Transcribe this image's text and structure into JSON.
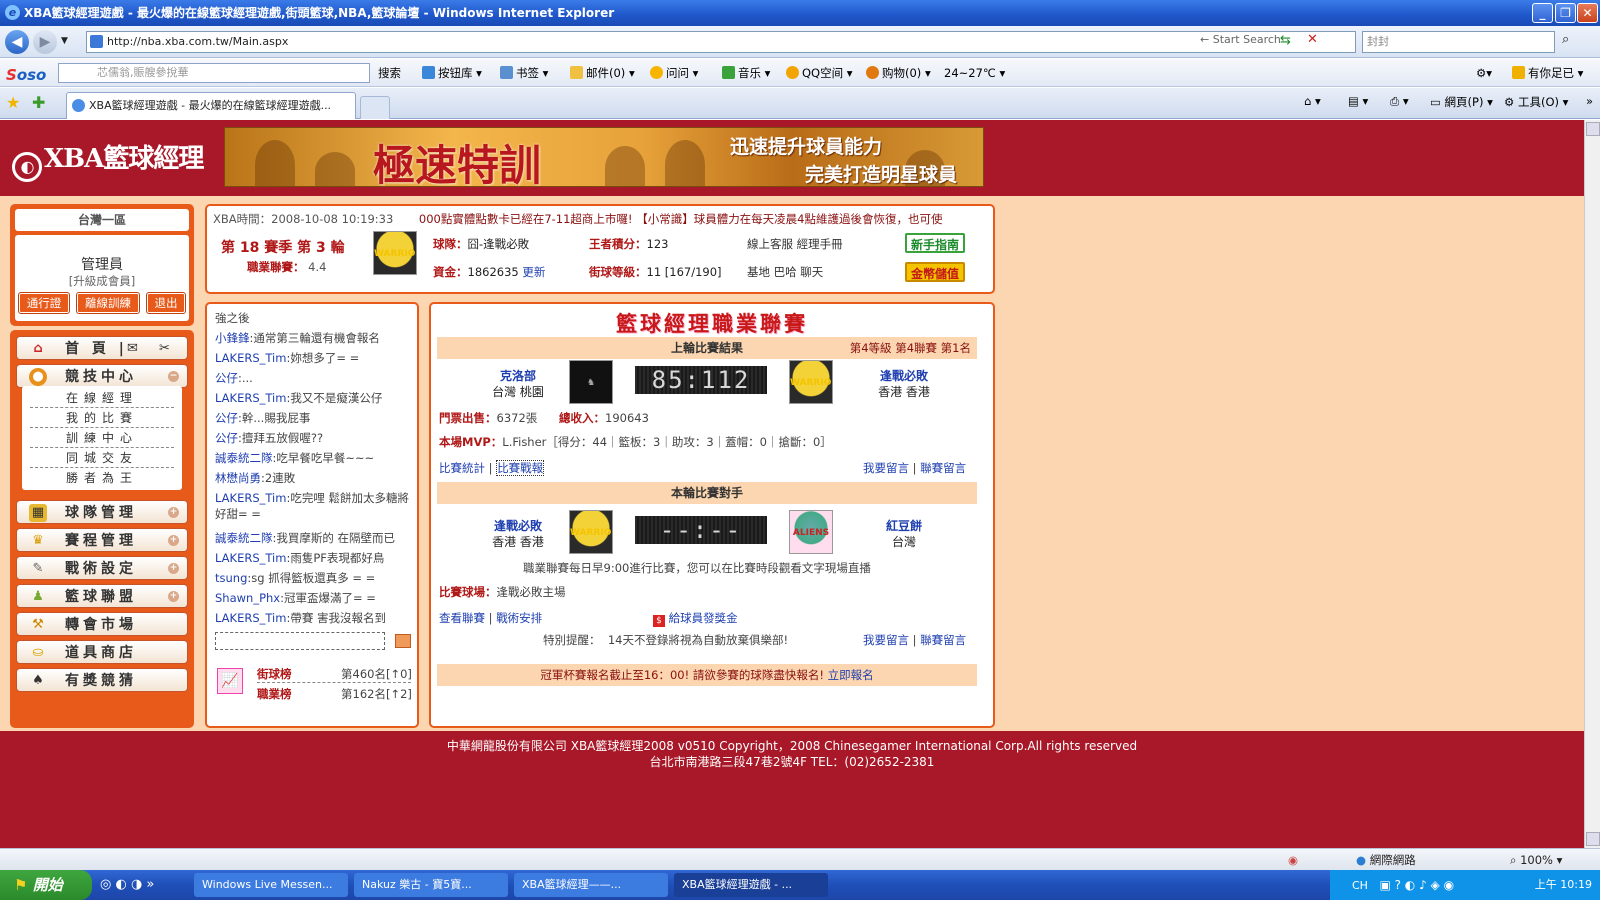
{
  "browser": {
    "window_title": "XBA籃球經理遊戲 - 最火爆的在線籃球經理遊戲,街頭籃球,NBA,籃球論壇 - Windows Internet Explorer",
    "address": "http://nba.xba.com.tw/Main.aspx",
    "start_search": "Start Search",
    "search_value": "封封",
    "soso_placeholder": "芯儒翁,賑艘參挩華",
    "soso_search": "搜索",
    "toolbar_items": [
      "按钮库",
      "书签",
      "邮件(0)",
      "问问",
      "音乐",
      "QQ空间",
      "购物(0)",
      "24~27℃"
    ],
    "toolbar_right": "有你足已",
    "tab_title": "XBA籃球經理遊戲 - 最火爆的在線籃球經理遊戲...",
    "tools_page": "網頁(P)",
    "tools_tools": "工具(O)"
  },
  "header": {
    "logo_text": "XBA籃球經理",
    "banner_main": "極速特訓",
    "banner_line1": "迅速提升球員能力",
    "banner_line2": "完美打造明星球員"
  },
  "user": {
    "server": "台灣一區",
    "name": "管理員",
    "upgrade": "[升級成會員]",
    "btn_pass": "通行證",
    "btn_offline": "離線訓練",
    "btn_exit": "退出"
  },
  "menu": {
    "home": "首 頁 |",
    "competition": "競技中心",
    "sub": [
      "在線經理",
      "我的比賽",
      "訓練中心",
      "同城交友",
      "勝者為王"
    ],
    "team_mgmt": "球隊管理",
    "schedule": "賽程管理",
    "tactics": "戰術設定",
    "league": "籃球聯盟",
    "transfer": "轉會市場",
    "shop": "道具商店",
    "lottery": "有獎競猜"
  },
  "info": {
    "time_label": "XBA時間：",
    "time_value": "2008-10-08 10:19:33",
    "marquee": "000點實體點數卡已經在7-11超商上市囉! 【小常識】球員體力在每天凌晨4點維護過後會恢復，也可使",
    "season": "第 18 賽季 第 3 輪",
    "pro_label": "職業聯賽：",
    "pro_value": "4.4",
    "team_label": "球隊：",
    "team_value": "囧-逢戰必敗",
    "king_label": "王者積分：",
    "king_value": "123",
    "service": "線上客服 經理手冊",
    "fund_label": "資金：",
    "fund_value": "1862635",
    "refresh": "更新",
    "street_label": "街球等級：",
    "street_value": "11 [167/190]",
    "base": "基地 巴哈 聊天",
    "guide_btn": "新手指南",
    "pay_btn": "金幣儲值"
  },
  "chat": {
    "header": "強之後",
    "messages": [
      {
        "user": "小鋒鋒",
        "text": "通常第三輪還有機會報名"
      },
      {
        "user": "LAKERS_Tim",
        "text": "妳想多了= ="
      },
      {
        "user": "公仔",
        "text": "..."
      },
      {
        "user": "LAKERS_Tim",
        "text": "我又不是癡漢公仔"
      },
      {
        "user": "公仔",
        "text": "幹...賜我屁事"
      },
      {
        "user": "公仔",
        "text": "擅拜五放假喔??"
      },
      {
        "user": "誠泰統二隊",
        "text": "吃早餐吃早餐~~~"
      },
      {
        "user": "林懋尚勇",
        "text": "2連敗"
      },
      {
        "user": "LAKERS_Tim",
        "text": "吃完哩 鬆餅加太多糖將 好甜= ="
      },
      {
        "user": "誠泰統二隊",
        "text": "我買摩斯的 在隔壁而已"
      },
      {
        "user": "LAKERS_Tim",
        "text": "雨隻PF表現都好鳥"
      },
      {
        "user": "tsung",
        "text": "sg 抓得籃板還真多 = ="
      },
      {
        "user": "Shawn_Phx",
        "text": "冠軍盃爆滿了= ="
      },
      {
        "user": "LAKERS_Tim",
        "text": "帶賽 害我沒報名到"
      }
    ],
    "rank1_label": "街球榜",
    "rank1_value": "第460名[↑0]",
    "rank2_label": "職業榜",
    "rank2_value": "第162名[↑2]"
  },
  "match": {
    "title": "籃球經理職業聯賽",
    "last_result": "上輪比賽結果",
    "last_info": "第4等級 第4聯賽 第1名",
    "home_team": "克洛部",
    "home_loc": "台灣 桃園",
    "score": "85:112",
    "away_team": "逢戰必敗",
    "away_loc": "香港 香港",
    "tickets_label": "門票出售：",
    "tickets_value": "6372張",
    "income_label": "總收入：",
    "income_value": "190643",
    "mvp_label": "本場MVP：",
    "mvp_value": "L.Fisher［得分：44｜籃板：3｜助攻：3｜蓋帽：0｜搶斷：0］",
    "stats_link": "比賽統計",
    "report_link": "比賽戰報",
    "msg_link1": "我要留言",
    "msg_link2": "聯賽留言",
    "next_opponent": "本輪比賽對手",
    "next_home": "逢戰必敗",
    "next_home_loc": "香港 香港",
    "next_score": "--:--",
    "next_away": "紅豆餅",
    "next_away_loc": "台灣",
    "daily_note": "職業聯賽每日早9:00進行比賽，您可以在比賽時段觀看文字現場直播",
    "venue_label": "比賽球場：",
    "venue_value": "逢戰必敗主場",
    "view_league": "查看聯賽",
    "tactics_link": "戰術安排",
    "bonus_link": "給球員發獎金",
    "reminder_label": "特別提醒：",
    "reminder_value": "14天不登錄將視為自動放棄俱樂部!",
    "msg_link3": "我要留言",
    "msg_link4": "聯賽留言",
    "cup_notice": "冠軍杯賽報名截止至16：00! 請欲參賽的球隊盡快報名!",
    "cup_link": "立即報名"
  },
  "footer": {
    "line1": "中華網龍股份有限公司 XBA籃球經理2008 v0510 Copyright，2008 Chinesegamer International Corp.All rights reserved",
    "line2": "台北市南港路三段47巷2號4F TEL：(02)2652-2381"
  },
  "statusbar": {
    "zone": "網際網路",
    "zoom": "100%"
  },
  "taskbar": {
    "start": "開始",
    "items": [
      "Windows Live Messen...",
      "Nakuz 樂古 - 寶5寶...",
      "XBA籃球經理——...",
      "XBA籃球經理遊戲 - ..."
    ],
    "lang": "CH",
    "clock": "上午 10:19"
  },
  "colors": {
    "page_red": "#a81828",
    "content_peach": "#fbd6b0",
    "panel_orange": "#e85a1a",
    "link_blue": "#1f3fb0"
  }
}
